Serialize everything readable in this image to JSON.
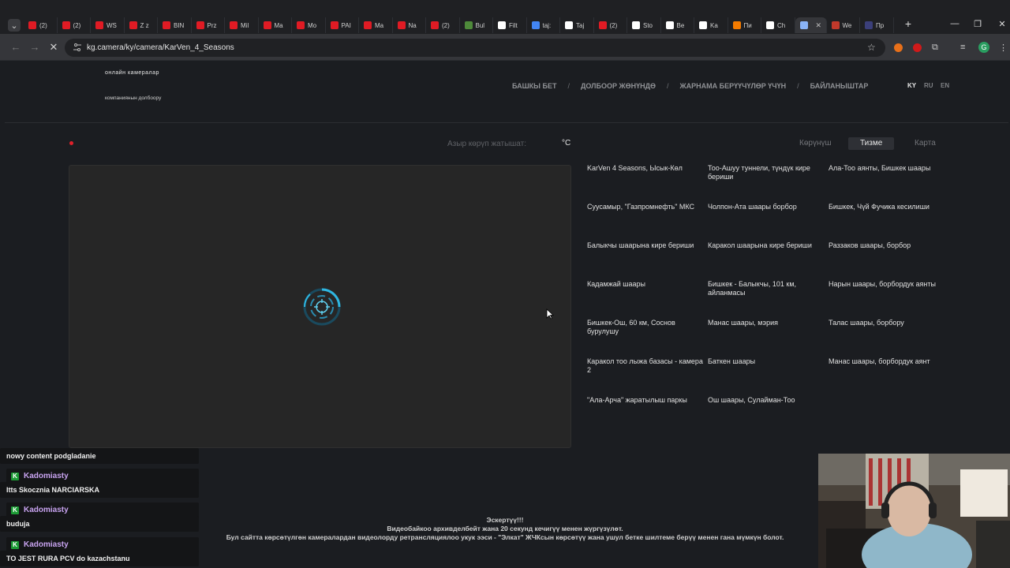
{
  "browser": {
    "tabs": [
      {
        "label": "(2)",
        "color": "#e01b24"
      },
      {
        "label": "(2)",
        "color": "#e01b24"
      },
      {
        "label": "WS",
        "color": "#e01b24"
      },
      {
        "label": "Z z",
        "color": "#e01b24"
      },
      {
        "label": "BIN",
        "color": "#e01b24"
      },
      {
        "label": "Prz",
        "color": "#e01b24"
      },
      {
        "label": "Mil",
        "color": "#e01b24"
      },
      {
        "label": "Ma",
        "color": "#e01b24"
      },
      {
        "label": "Mo",
        "color": "#e01b24"
      },
      {
        "label": "PAI",
        "color": "#e01b24"
      },
      {
        "label": "Ma",
        "color": "#e01b24"
      },
      {
        "label": "Na",
        "color": "#e01b24"
      },
      {
        "label": "(2)",
        "color": "#e01b24"
      },
      {
        "label": "Bul",
        "color": "#4e8a3a"
      },
      {
        "label": "Filt",
        "color": "#ffffff"
      },
      {
        "label": "taj:",
        "color": "#4285f4"
      },
      {
        "label": "Taj",
        "color": "#ffffff"
      },
      {
        "label": "(2)",
        "color": "#e01b24"
      },
      {
        "label": "Sto",
        "color": "#ffffff"
      },
      {
        "label": "Be",
        "color": "#ffffff"
      },
      {
        "label": "Ka",
        "color": "#ffffff"
      },
      {
        "label": "Пи",
        "color": "#f57c00"
      },
      {
        "label": "Ch",
        "color": "#ffffff"
      },
      {
        "label": "",
        "color": "#8ab4f8",
        "active": true
      },
      {
        "label": "We",
        "color": "#c0392b"
      },
      {
        "label": "Пр",
        "color": "#3b3f7a"
      }
    ],
    "url": "kg.camera/ky/camera/KarVen_4_Seasons",
    "profile_initial": "G"
  },
  "site": {
    "brand_line1": "онлайн камералар",
    "brand_line2": "компаниянын долбоору",
    "nav": [
      "БАШКЫ БЕТ",
      "ДОЛБООР ЖӨНҮНДӨ",
      "ЖАРНАМА БЕРҮҮЧҮЛӨР ҮЧҮН",
      "БАЙЛАНЫШТАР"
    ],
    "languages": [
      "KY",
      "RU",
      "EN"
    ],
    "temp_label": "Азыр көрүп жатышат:",
    "temp_unit": "°C",
    "view_tabs": [
      "Көрүнүш",
      "Тизме",
      "Карта"
    ],
    "cameras": [
      "KarVen 4 Seasons, Ысык-Көл",
      "Тоо-Ашуу туннели, түндүк кире бериши",
      "Ала-Тоо аянты, Бишкек шаары",
      "Суусамыр, \"Газпромнефть\" МКС",
      "Чолпон-Ата шаары борбор",
      "Бишкек, Чүй Фучика кесилиши",
      "Балыкчы шаарына кире бериши",
      "Каракол шаарына кире бериши",
      "Раззаков шаары, борбор",
      "Кадамжай шаары",
      "Бишкек - Балыкчы, 101 км, айланмасы",
      "Нарын шаары, борбордук аянты",
      "Бишкек-Ош, 60 км, Соснов бурулушу",
      "Манас шаары, мэрия",
      "Талас шаары, борбору",
      "Каракол тоо лыжа базасы - камера 2",
      "Баткен шаары",
      "Манас шаары, борбордук аянт",
      "\"Ала-Арча\" жаратылыш паркы",
      "Ош шаары, Сулайман-Тоо"
    ],
    "notice": [
      "Эскертүү!!!",
      "Видеобайкоо архивделбейт жана 20 секунд кечигүү менен жүргүзүлөт.",
      "Бул сайтта көрсөтүлгөн камералардан видеолорду ретрансляциялоо укук ээси - \"Элкат\" ЖЧКсын көрсөтүү жана ушул бетке шилтеме берүү менен гана мүмкүн болот."
    ]
  },
  "chat": {
    "messages": [
      {
        "text": "nowy content podgladanie"
      },
      {
        "user": "Kadomiasty",
        "text": "Itts Skocznia NARCIARSKA"
      },
      {
        "user": "Kadomiasty",
        "text": "buduja"
      },
      {
        "user": "Kadomiasty",
        "text": "TO JEST RURA PCV do kazachstanu"
      }
    ]
  }
}
